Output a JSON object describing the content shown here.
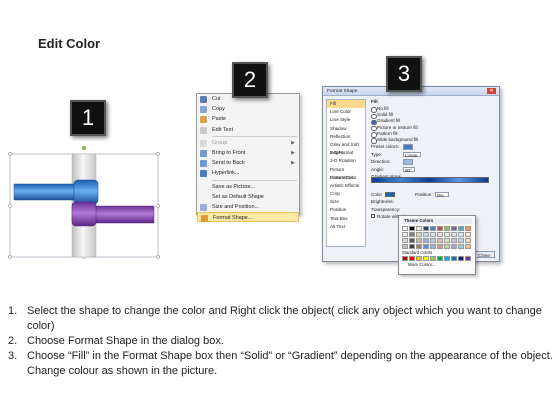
{
  "header": {
    "title": "Edit Color"
  },
  "steps": [
    {
      "number": "1"
    },
    {
      "number": "2"
    },
    {
      "number": "3"
    }
  ],
  "context_menu": {
    "items": [
      {
        "label": "Cut",
        "icon": "scissors-icon"
      },
      {
        "label": "Copy",
        "icon": "copy-icon"
      },
      {
        "label": "Paste",
        "icon": "paste-icon"
      },
      {
        "label": "Edit Text",
        "icon": "edit-text-icon"
      },
      {
        "label": "Group",
        "icon": "group-icon",
        "disabled": true
      },
      {
        "label": "Bring to Front",
        "icon": "bring-front-icon"
      },
      {
        "label": "Send to Back",
        "icon": "send-back-icon"
      },
      {
        "label": "Hyperlink...",
        "icon": "hyperlink-icon"
      },
      {
        "label": "Save as Picture...",
        "icon": ""
      },
      {
        "label": "Set as Default Shape",
        "icon": ""
      },
      {
        "label": "Size and Position...",
        "icon": "size-icon"
      },
      {
        "label": "Format Shape...",
        "icon": "format-shape-icon"
      }
    ]
  },
  "format_dialog": {
    "title": "Format Shape",
    "categories": [
      "Fill",
      "Line Color",
      "Line Style",
      "Shadow",
      "Reflection",
      "Glow and Soft Edges",
      "3-D Format",
      "3-D Rotation",
      "Picture Corrections",
      "Picture Color",
      "Artistic Effects",
      "Crop",
      "Size",
      "Position",
      "Text Box",
      "Alt Text"
    ],
    "fill_heading": "Fill",
    "fill_options": [
      "No fill",
      "Solid fill",
      "Gradient fill",
      "Picture or texture fill",
      "Pattern fill",
      "Slide background fill"
    ],
    "fields": [
      {
        "label": "Preset colors:"
      },
      {
        "label": "Type:",
        "value": "Linear"
      },
      {
        "label": "Direction:"
      },
      {
        "label": "Angle:",
        "value": "90°"
      }
    ],
    "gradient_stops_label": "Gradient stops",
    "color_label": "Color",
    "position_label": "Position:",
    "position_value": "0%",
    "brightness_label": "Brightness:",
    "transparency_label": "Transparency:",
    "rotate_label": "Rotate with shape",
    "close_label": "Close"
  },
  "color_picker": {
    "theme_label": "Theme Colors",
    "standard_label": "Standard Colors",
    "more_label": "More Colors...",
    "theme_colors": [
      "#ffffff",
      "#000000",
      "#eeece1",
      "#1f497d",
      "#4f81bd",
      "#c0504d",
      "#9bbb59",
      "#8064a2",
      "#4bacc6",
      "#f79646",
      "#f2f2f2",
      "#7f7f7f",
      "#ddd9c3",
      "#c6d9f0",
      "#dbe5f1",
      "#f2dcdb",
      "#ebf1dd",
      "#e5e0ec",
      "#dbeef3",
      "#fdeada",
      "#d8d8d8",
      "#595959",
      "#c4bd97",
      "#8db3e2",
      "#b8cce4",
      "#e5b9b7",
      "#d7e3bc",
      "#ccc1d9",
      "#b7dde8",
      "#fbd5b5",
      "#bfbfbf",
      "#3f3f3f",
      "#938953",
      "#548dd4",
      "#95b3d7",
      "#d99694",
      "#c3d69b",
      "#b2a2c7",
      "#92cddc",
      "#fac08f",
      "#a5a5a5",
      "#262626",
      "#494429",
      "#17365d",
      "#366092",
      "#953734",
      "#76923c",
      "#5f497a",
      "#31859b",
      "#e36c09"
    ],
    "standard_colors": [
      "#c00000",
      "#ff0000",
      "#ffc000",
      "#ffff00",
      "#92d050",
      "#00b050",
      "#00b0f0",
      "#0070c0",
      "#002060",
      "#7030a0"
    ]
  },
  "instructions": [
    {
      "number": "1.",
      "text": "Select the shape to change the color and Right click the object( click any object which you want to change color)"
    },
    {
      "number": "2.",
      "text": "Choose Format Shape in the dialog box."
    },
    {
      "number": "3.",
      "text": "Choose “Fill” in the Format Shape box then “Solid” or “Gradient” depending on the appearance of the object. Change colour as shown in the picture."
    }
  ],
  "colors": {
    "pipe_blue": "#2f7fd6",
    "pipe_purple": "#8b4fb8",
    "pipe_gray": "#e3e3e3",
    "menu_highlight": "#fde9a6"
  }
}
